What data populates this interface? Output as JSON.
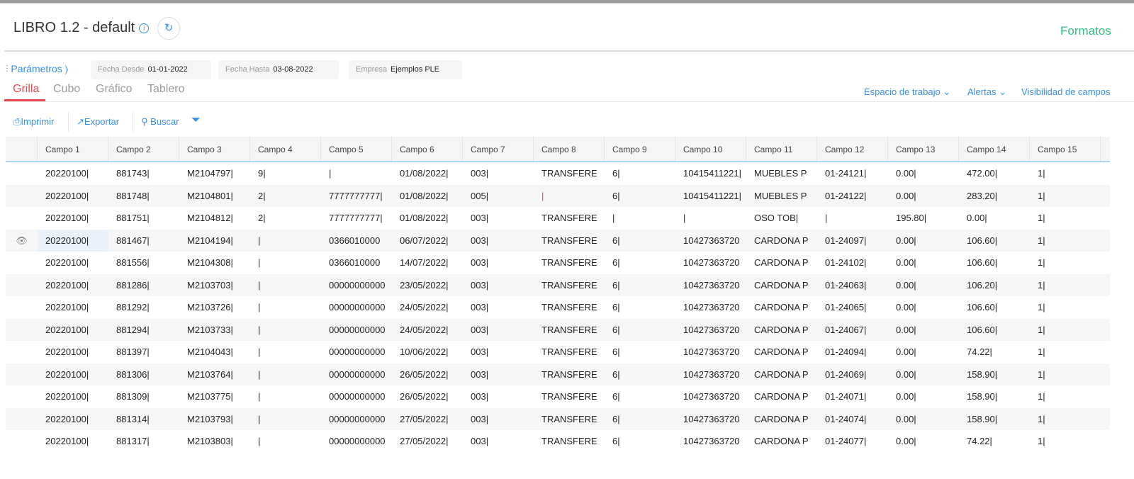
{
  "header": {
    "title": "LIBRO 1.2 - default",
    "formatos": "Formatos"
  },
  "params": {
    "label": "Parámetros",
    "fecha_desde_label": "Fecha Desde",
    "fecha_desde": "01-01-2022",
    "fecha_hasta_label": "Fecha Hasta",
    "fecha_hasta": "03-08-2022",
    "empresa_label": "Empresa",
    "empresa": "Ejemplos PLE"
  },
  "tabs": [
    "Grilla",
    "Cubo",
    "Gráfico",
    "Tablero"
  ],
  "right_links": [
    "Espacio de trabajo",
    "Alertas",
    "Visibilidad de campos"
  ],
  "toolbar": {
    "print": "Imprimir",
    "export": "Exportar",
    "search": "Buscar"
  },
  "columns": [
    "Campo 1",
    "Campo 2",
    "Campo 3",
    "Campo 4",
    "Campo 5",
    "Campo 6",
    "Campo 7",
    "Campo 8",
    "Campo 9",
    "Campo 10",
    "Campo 11",
    "Campo 12",
    "Campo 13",
    "Campo 14",
    "Campo 15"
  ],
  "rows": [
    [
      "20220100|",
      "881743|",
      "M2104797|",
      "9|",
      "|",
      "01/08/2022|",
      "003|",
      "TRANSFERE",
      "6|",
      "10415411221|",
      "MUEBLES P",
      "01-24121|",
      "0.00|",
      "472.00|",
      "1|"
    ],
    [
      "20220100|",
      "881748|",
      "M2104801|",
      "2|",
      "7777777777|",
      "01/08/2022|",
      "005|",
      "|",
      "6|",
      "10415411221|",
      "MUEBLES P",
      "01-24122|",
      "0.00|",
      "283.20|",
      "1|"
    ],
    [
      "20220100|",
      "881751|",
      "M2104812|",
      "2|",
      "7777777777|",
      "01/08/2022|",
      "003|",
      "TRANSFERE",
      "|",
      "|",
      "OSO TOB|",
      "|",
      "195.80|",
      "0.00|",
      "1|"
    ],
    [
      "20220100|",
      "881467|",
      "M2104194|",
      "|",
      "0366010000",
      "06/07/2022|",
      "003|",
      "TRANSFERE",
      "6|",
      "10427363720",
      "CARDONA P",
      "01-24097|",
      "0.00|",
      "106.60|",
      "1|"
    ],
    [
      "20220100|",
      "881556|",
      "M2104308|",
      "|",
      "0366010000",
      "14/07/2022|",
      "003|",
      "TRANSFERE",
      "6|",
      "10427363720",
      "CARDONA P",
      "01-24102|",
      "0.00|",
      "106.60|",
      "1|"
    ],
    [
      "20220100|",
      "881286|",
      "M2103703|",
      "|",
      "00000000000",
      "23/05/2022|",
      "003|",
      "TRANSFERE",
      "6|",
      "10427363720",
      "CARDONA P",
      "01-24063|",
      "0.00|",
      "106.20|",
      "1|"
    ],
    [
      "20220100|",
      "881292|",
      "M2103726|",
      "|",
      "00000000000",
      "24/05/2022|",
      "003|",
      "TRANSFERE",
      "6|",
      "10427363720",
      "CARDONA P",
      "01-24065|",
      "0.00|",
      "106.60|",
      "1|"
    ],
    [
      "20220100|",
      "881294|",
      "M2103733|",
      "|",
      "00000000000",
      "24/05/2022|",
      "003|",
      "TRANSFERE",
      "6|",
      "10427363720",
      "CARDONA P",
      "01-24067|",
      "0.00|",
      "106.60|",
      "1|"
    ],
    [
      "20220100|",
      "881397|",
      "M2104043|",
      "|",
      "00000000000",
      "10/06/2022|",
      "003|",
      "TRANSFERE",
      "6|",
      "10427363720",
      "CARDONA P",
      "01-24094|",
      "0.00|",
      "74.22|",
      "1|"
    ],
    [
      "20220100|",
      "881306|",
      "M2103764|",
      "|",
      "00000000000",
      "26/05/2022|",
      "003|",
      "TRANSFERE",
      "6|",
      "10427363720",
      "CARDONA P",
      "01-24069|",
      "0.00|",
      "158.90|",
      "1|"
    ],
    [
      "20220100|",
      "881309|",
      "M2103775|",
      "|",
      "00000000000",
      "26/05/2022|",
      "003|",
      "TRANSFERE",
      "6|",
      "10427363720",
      "CARDONA P",
      "01-24071|",
      "0.00|",
      "158.90|",
      "1|"
    ],
    [
      "20220100|",
      "881314|",
      "M2103793|",
      "|",
      "00000000000",
      "27/05/2022|",
      "003|",
      "TRANSFERE",
      "6|",
      "10427363720",
      "CARDONA P",
      "01-24074|",
      "0.00|",
      "158.90|",
      "1|"
    ],
    [
      "20220100|",
      "881317|",
      "M2103803|",
      "|",
      "00000000000",
      "27/05/2022|",
      "003|",
      "TRANSFERE",
      "6|",
      "10427363720",
      "CARDONA P",
      "01-24077|",
      "0.00|",
      "74.22|",
      "1|"
    ]
  ]
}
